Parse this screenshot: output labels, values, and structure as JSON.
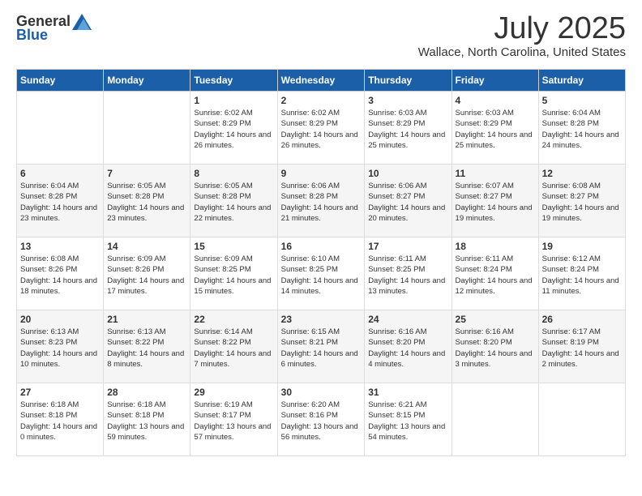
{
  "logo": {
    "general": "General",
    "blue": "Blue"
  },
  "header": {
    "month": "July 2025",
    "location": "Wallace, North Carolina, United States"
  },
  "weekdays": [
    "Sunday",
    "Monday",
    "Tuesday",
    "Wednesday",
    "Thursday",
    "Friday",
    "Saturday"
  ],
  "weeks": [
    [
      {
        "day": "",
        "info": ""
      },
      {
        "day": "",
        "info": ""
      },
      {
        "day": "1",
        "info": "Sunrise: 6:02 AM\nSunset: 8:29 PM\nDaylight: 14 hours and 26 minutes."
      },
      {
        "day": "2",
        "info": "Sunrise: 6:02 AM\nSunset: 8:29 PM\nDaylight: 14 hours and 26 minutes."
      },
      {
        "day": "3",
        "info": "Sunrise: 6:03 AM\nSunset: 8:29 PM\nDaylight: 14 hours and 25 minutes."
      },
      {
        "day": "4",
        "info": "Sunrise: 6:03 AM\nSunset: 8:29 PM\nDaylight: 14 hours and 25 minutes."
      },
      {
        "day": "5",
        "info": "Sunrise: 6:04 AM\nSunset: 8:28 PM\nDaylight: 14 hours and 24 minutes."
      }
    ],
    [
      {
        "day": "6",
        "info": "Sunrise: 6:04 AM\nSunset: 8:28 PM\nDaylight: 14 hours and 23 minutes."
      },
      {
        "day": "7",
        "info": "Sunrise: 6:05 AM\nSunset: 8:28 PM\nDaylight: 14 hours and 23 minutes."
      },
      {
        "day": "8",
        "info": "Sunrise: 6:05 AM\nSunset: 8:28 PM\nDaylight: 14 hours and 22 minutes."
      },
      {
        "day": "9",
        "info": "Sunrise: 6:06 AM\nSunset: 8:28 PM\nDaylight: 14 hours and 21 minutes."
      },
      {
        "day": "10",
        "info": "Sunrise: 6:06 AM\nSunset: 8:27 PM\nDaylight: 14 hours and 20 minutes."
      },
      {
        "day": "11",
        "info": "Sunrise: 6:07 AM\nSunset: 8:27 PM\nDaylight: 14 hours and 19 minutes."
      },
      {
        "day": "12",
        "info": "Sunrise: 6:08 AM\nSunset: 8:27 PM\nDaylight: 14 hours and 19 minutes."
      }
    ],
    [
      {
        "day": "13",
        "info": "Sunrise: 6:08 AM\nSunset: 8:26 PM\nDaylight: 14 hours and 18 minutes."
      },
      {
        "day": "14",
        "info": "Sunrise: 6:09 AM\nSunset: 8:26 PM\nDaylight: 14 hours and 17 minutes."
      },
      {
        "day": "15",
        "info": "Sunrise: 6:09 AM\nSunset: 8:25 PM\nDaylight: 14 hours and 15 minutes."
      },
      {
        "day": "16",
        "info": "Sunrise: 6:10 AM\nSunset: 8:25 PM\nDaylight: 14 hours and 14 minutes."
      },
      {
        "day": "17",
        "info": "Sunrise: 6:11 AM\nSunset: 8:25 PM\nDaylight: 14 hours and 13 minutes."
      },
      {
        "day": "18",
        "info": "Sunrise: 6:11 AM\nSunset: 8:24 PM\nDaylight: 14 hours and 12 minutes."
      },
      {
        "day": "19",
        "info": "Sunrise: 6:12 AM\nSunset: 8:24 PM\nDaylight: 14 hours and 11 minutes."
      }
    ],
    [
      {
        "day": "20",
        "info": "Sunrise: 6:13 AM\nSunset: 8:23 PM\nDaylight: 14 hours and 10 minutes."
      },
      {
        "day": "21",
        "info": "Sunrise: 6:13 AM\nSunset: 8:22 PM\nDaylight: 14 hours and 8 minutes."
      },
      {
        "day": "22",
        "info": "Sunrise: 6:14 AM\nSunset: 8:22 PM\nDaylight: 14 hours and 7 minutes."
      },
      {
        "day": "23",
        "info": "Sunrise: 6:15 AM\nSunset: 8:21 PM\nDaylight: 14 hours and 6 minutes."
      },
      {
        "day": "24",
        "info": "Sunrise: 6:16 AM\nSunset: 8:20 PM\nDaylight: 14 hours and 4 minutes."
      },
      {
        "day": "25",
        "info": "Sunrise: 6:16 AM\nSunset: 8:20 PM\nDaylight: 14 hours and 3 minutes."
      },
      {
        "day": "26",
        "info": "Sunrise: 6:17 AM\nSunset: 8:19 PM\nDaylight: 14 hours and 2 minutes."
      }
    ],
    [
      {
        "day": "27",
        "info": "Sunrise: 6:18 AM\nSunset: 8:18 PM\nDaylight: 14 hours and 0 minutes."
      },
      {
        "day": "28",
        "info": "Sunrise: 6:18 AM\nSunset: 8:18 PM\nDaylight: 13 hours and 59 minutes."
      },
      {
        "day": "29",
        "info": "Sunrise: 6:19 AM\nSunset: 8:17 PM\nDaylight: 13 hours and 57 minutes."
      },
      {
        "day": "30",
        "info": "Sunrise: 6:20 AM\nSunset: 8:16 PM\nDaylight: 13 hours and 56 minutes."
      },
      {
        "day": "31",
        "info": "Sunrise: 6:21 AM\nSunset: 8:15 PM\nDaylight: 13 hours and 54 minutes."
      },
      {
        "day": "",
        "info": ""
      },
      {
        "day": "",
        "info": ""
      }
    ]
  ]
}
